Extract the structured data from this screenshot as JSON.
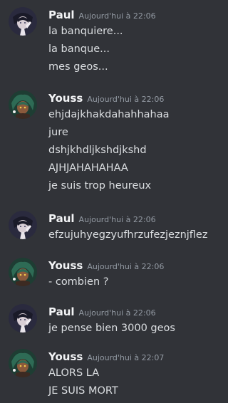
{
  "colors": {
    "background": "#313338",
    "username": "#f2f3f5",
    "timestamp": "#949ba4",
    "message_text": "#dbdee1",
    "paul_avatar_bg": "#2a2a3e",
    "youss_avatar_bg": "#1e3d33"
  },
  "messages": [
    {
      "author": "Paul",
      "avatar_icon": "paul-avatar-icon",
      "timestamp": "Aujourd'hui à 22:06",
      "lines": [
        "la banquiere...",
        "la banque...",
        "mes geos..."
      ]
    },
    {
      "author": "Youss",
      "avatar_icon": "youss-avatar-icon",
      "timestamp": "Aujourd'hui à 22:06",
      "lines": [
        "ehjdajkhakdahahhahaa",
        "jure",
        "dshjkhdljkshdjkshd",
        "AJHJAHAHAHAA",
        "je suis trop heureux"
      ]
    },
    {
      "author": "Paul",
      "avatar_icon": "paul-avatar-icon",
      "timestamp": "Aujourd'hui à 22:06",
      "lines": [
        "efzujuhyegzyufhrzufezjeznjflez"
      ]
    },
    {
      "author": "Youss",
      "avatar_icon": "youss-avatar-icon",
      "timestamp": "Aujourd'hui à 22:06",
      "lines": [
        "- combien ?"
      ]
    },
    {
      "author": "Paul",
      "avatar_icon": "paul-avatar-icon",
      "timestamp": "Aujourd'hui à 22:06",
      "lines": [
        "je pense bien 3000 geos"
      ]
    },
    {
      "author": "Youss",
      "avatar_icon": "youss-avatar-icon",
      "timestamp": "Aujourd'hui à 22:07",
      "lines": [
        "ALORS LA",
        "JE SUIS MORT"
      ]
    }
  ]
}
